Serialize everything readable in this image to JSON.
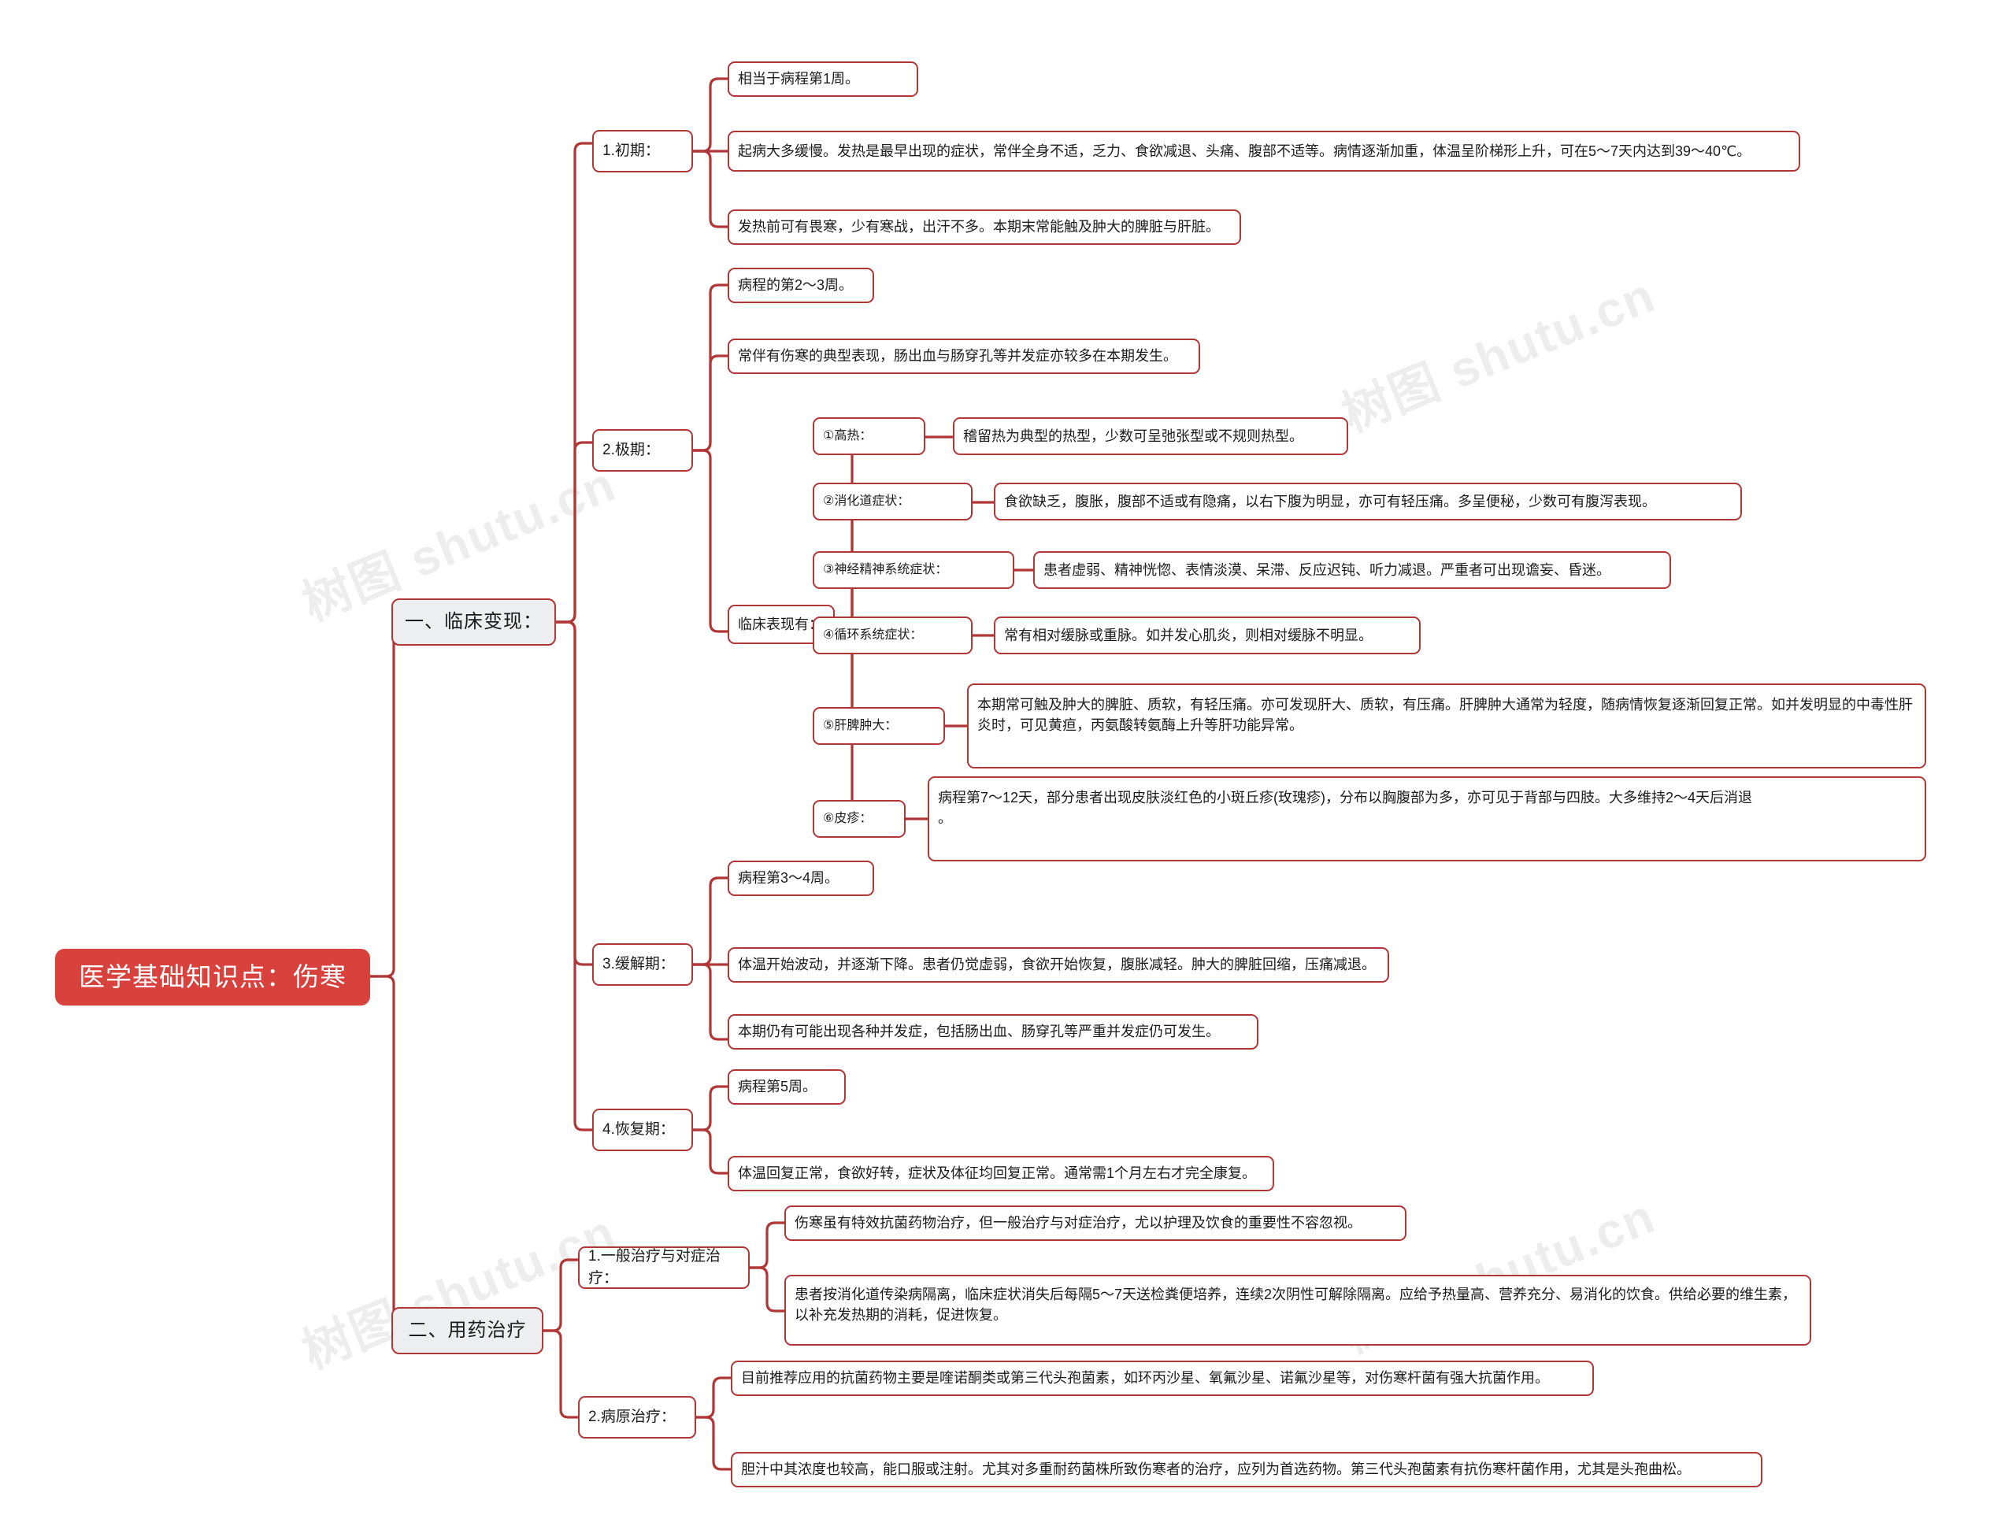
{
  "theme": {
    "root_bg": "#d8413c",
    "root_text": "#ffffff",
    "branch_bg": "#eceef0",
    "node_border": "#b13636",
    "node_bg": "#ffffff",
    "text": "#1b1b1b",
    "canvas_bg": "#ffffff"
  },
  "watermark": {
    "text": "树图 shutu.cn"
  },
  "root": {
    "label": "医学基础知识点：伤寒"
  },
  "branches": [
    {
      "label": "一、临床变现：",
      "children": [
        {
          "label": "1.初期：",
          "children": [
            {
              "label": "相当于病程第1周。"
            },
            {
              "label": "起病大多缓慢。发热是最早出现的症状，常伴全身不适，乏力、食欲减退、头痛、腹部不适等。病情逐渐加重，体温呈阶梯形上升，可在5～7天内达到39～40℃。"
            },
            {
              "label": "发热前可有畏寒，少有寒战，出汗不多。本期末常能触及肿大的脾脏与肝脏。"
            }
          ]
        },
        {
          "label": "2.极期：",
          "children": [
            {
              "label": "病程的第2～3周。"
            },
            {
              "label": "常伴有伤寒的典型表现，肠出血与肠穿孔等并发症亦较多在本期发生。"
            },
            {
              "label": "临床表现有：",
              "children": [
                {
                  "label": "①高热：",
                  "detail": "稽留热为典型的热型，少数可呈弛张型或不规则热型。"
                },
                {
                  "label": "②消化道症状：",
                  "detail": "食欲缺乏，腹胀，腹部不适或有隐痛，以右下腹为明显，亦可有轻压痛。多呈便秘，少数可有腹泻表现。"
                },
                {
                  "label": "③神经精神系统症状：",
                  "detail": "患者虚弱、精神恍惚、表情淡漠、呆滞、反应迟钝、听力减退。严重者可出现谵妄、昏迷。"
                },
                {
                  "label": "④循环系统症状：",
                  "detail": "常有相对缓脉或重脉。如并发心肌炎，则相对缓脉不明显。"
                },
                {
                  "label": "⑤肝脾肿大：",
                  "detail": "本期常可触及肿大的脾脏、质软，有轻压痛。亦可发现肝大、质软，有压痛。肝脾肿大通常为轻度，随病情恢复逐渐回复正常。如并发明显的中毒性肝炎时，可见黄疸，丙氨酸转氨酶上升等肝功能异常。"
                },
                {
                  "label": "⑥皮疹：",
                  "detail": "病程第7～12天，部分患者出现皮肤淡红色的小斑丘疹(玫瑰疹)，分布以胸腹部为多，亦可见于背部与四肢。大多维持2～4天后消退\n。"
                }
              ]
            }
          ]
        },
        {
          "label": "3.缓解期：",
          "children": [
            {
              "label": "病程第3～4周。"
            },
            {
              "label": "体温开始波动，并逐渐下降。患者仍觉虚弱，食欲开始恢复，腹胀减轻。肿大的脾脏回缩，压痛减退。"
            },
            {
              "label": "本期仍有可能出现各种并发症，包括肠出血、肠穿孔等严重并发症仍可发生。"
            }
          ]
        },
        {
          "label": "4.恢复期：",
          "children": [
            {
              "label": "病程第5周。"
            },
            {
              "label": "体温回复正常，食欲好转，症状及体征均回复正常。通常需1个月左右才完全康复。"
            }
          ]
        }
      ]
    },
    {
      "label": "二、用药治疗",
      "children": [
        {
          "label": "1.一般治疗与对症治疗：",
          "children": [
            {
              "label": "伤寒虽有特效抗菌药物治疗，但一般治疗与对症治疗，尤以护理及饮食的重要性不容忽视。"
            },
            {
              "label": "患者按消化道传染病隔离，临床症状消失后每隔5～7天送检粪便培养，连续2次阴性可解除隔离。应给予热量高、营养充分、易消化的饮食。供给必要的维生素，以补充发热期的消耗，促进恢复。"
            }
          ]
        },
        {
          "label": "2.病原治疗：",
          "children": [
            {
              "label": "目前推荐应用的抗菌药物主要是喹诺酮类或第三代头孢菌素，如环丙沙星、氧氟沙星、诺氟沙星等，对伤寒杆菌有强大抗菌作用。"
            },
            {
              "label": "胆汁中其浓度也较高，能口服或注射。尤其对多重耐药菌株所致伤寒者的治疗，应列为首选药物。第三代头孢菌素有抗伤寒杆菌作用，尤其是头孢曲松。"
            }
          ]
        }
      ]
    }
  ]
}
